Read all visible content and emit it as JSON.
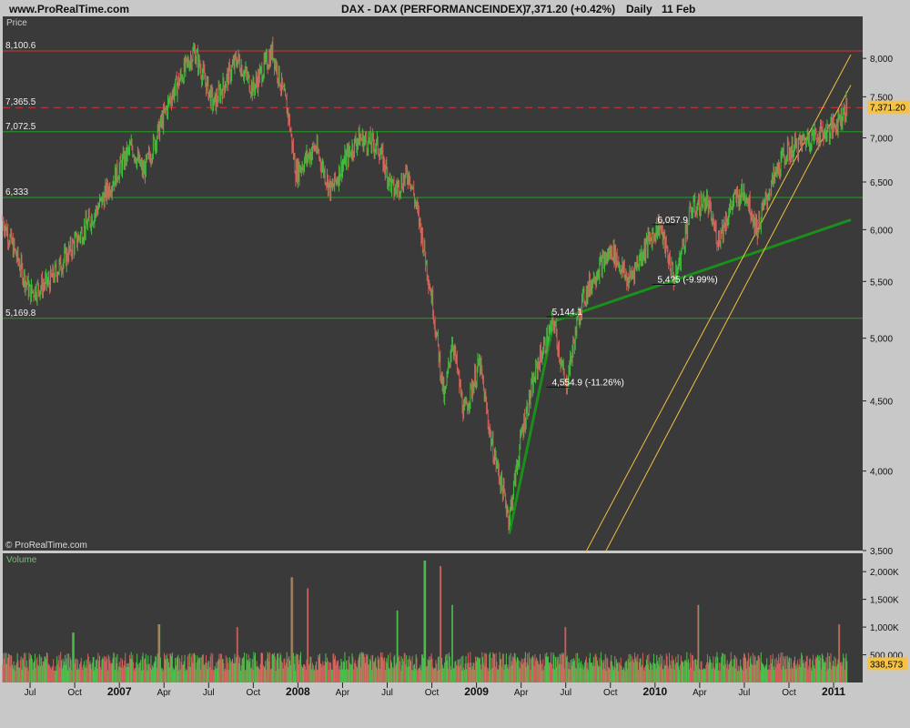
{
  "header": {
    "site": "www.ProRealTime.com",
    "instrument": "DAX - DAX (PERFORMANCEINDEX)",
    "quote": "7,371.20 (+0.42%)",
    "period": "Daily",
    "date": "11 Feb"
  },
  "chart_data": [
    {
      "type": "line",
      "panel_label": "Price",
      "watermark": "© ProRealTime.com",
      "x_labels": [
        "Jul",
        "Oct",
        "2007",
        "Apr",
        "Jul",
        "Oct",
        "2008",
        "Apr",
        "Jul",
        "Oct",
        "2009",
        "Apr",
        "Jul",
        "Oct",
        "2010",
        "Apr",
        "Jul",
        "Oct",
        "2011"
      ],
      "yaxis_ticks": [
        "8,000",
        "7,500",
        "7,000",
        "6,500",
        "6,000",
        "5,500",
        "5,000",
        "4,500",
        "4,000",
        "3,500"
      ],
      "ylim": [
        3500,
        8200
      ],
      "y_scale": "log",
      "last_price_label": "7,371.20",
      "anchors": [
        {
          "t": 0,
          "v": 6100
        },
        {
          "t": 0.035,
          "v": 5400
        },
        {
          "t": 0.06,
          "v": 5500
        },
        {
          "t": 0.12,
          "v": 6200
        },
        {
          "t": 0.165,
          "v": 6900
        },
        {
          "t": 0.18,
          "v": 6600
        },
        {
          "t": 0.215,
          "v": 7500
        },
        {
          "t": 0.245,
          "v": 8100
        },
        {
          "t": 0.27,
          "v": 7400
        },
        {
          "t": 0.3,
          "v": 8000
        },
        {
          "t": 0.32,
          "v": 7600
        },
        {
          "t": 0.345,
          "v": 8100
        },
        {
          "t": 0.365,
          "v": 7300
        },
        {
          "t": 0.375,
          "v": 6600
        },
        {
          "t": 0.4,
          "v": 6900
        },
        {
          "t": 0.42,
          "v": 6400
        },
        {
          "t": 0.435,
          "v": 6700
        },
        {
          "t": 0.455,
          "v": 7000
        },
        {
          "t": 0.48,
          "v": 6900
        },
        {
          "t": 0.5,
          "v": 6400
        },
        {
          "t": 0.52,
          "v": 6600
        },
        {
          "t": 0.535,
          "v": 6000
        },
        {
          "t": 0.55,
          "v": 5300
        },
        {
          "t": 0.565,
          "v": 4500
        },
        {
          "t": 0.575,
          "v": 5000
        },
        {
          "t": 0.59,
          "v": 4400
        },
        {
          "t": 0.61,
          "v": 4800
        },
        {
          "t": 0.625,
          "v": 4200
        },
        {
          "t": 0.648,
          "v": 3700
        },
        {
          "t": 0.665,
          "v": 4300
        },
        {
          "t": 0.685,
          "v": 4800
        },
        {
          "t": 0.705,
          "v": 5144
        },
        {
          "t": 0.72,
          "v": 4600
        },
        {
          "t": 0.74,
          "v": 5300
        },
        {
          "t": 0.76,
          "v": 5600
        },
        {
          "t": 0.78,
          "v": 5800
        },
        {
          "t": 0.8,
          "v": 5500
        },
        {
          "t": 0.82,
          "v": 5800
        },
        {
          "t": 0.84,
          "v": 6058
        },
        {
          "t": 0.86,
          "v": 5500
        },
        {
          "t": 0.88,
          "v": 6200
        },
        {
          "t": 0.9,
          "v": 6300
        },
        {
          "t": 0.915,
          "v": 5900
        },
        {
          "t": 0.935,
          "v": 6300
        },
        {
          "t": 0.95,
          "v": 6400
        },
        {
          "t": 0.965,
          "v": 6000
        },
        {
          "t": 0.98,
          "v": 6400
        },
        {
          "t": 0.99,
          "v": 6600
        },
        {
          "t": 1.0,
          "v": 6800
        },
        {
          "t": 1.03,
          "v": 7000
        },
        {
          "t": 1.06,
          "v": 7100
        },
        {
          "t": 1.08,
          "v": 7371
        }
      ],
      "horizontal_levels": [
        {
          "label": "8,100.6",
          "value": 8100.6,
          "style": "solid",
          "color": "#e03030"
        },
        {
          "label": "7,365.5",
          "value": 7365.5,
          "style": "dashed",
          "color": "#e03030"
        },
        {
          "label": "7,072.5",
          "value": 7072.5,
          "style": "solid",
          "color": "#20a020"
        },
        {
          "label": "6,333",
          "value": 6333,
          "style": "solid",
          "color": "#20a020"
        },
        {
          "label": "5,169.8",
          "value": 5169.8,
          "style": "solid",
          "color": "#20a020"
        }
      ],
      "annotations": [
        {
          "text": "6,057.9",
          "t": 0.84,
          "v": 6070
        },
        {
          "text": "5,144.1",
          "t": 0.705,
          "v": 5200
        },
        {
          "text": "4,554.9 (-11.26%)",
          "t": 0.705,
          "v": 4620
        },
        {
          "text": "5,4?5 (-9.99%)",
          "t": 0.84,
          "v": 5490
        }
      ]
    },
    {
      "type": "bar",
      "panel_label": "Volume",
      "yaxis_ticks": [
        "2,000K",
        "1,500K",
        "1,000K",
        "500,000"
      ],
      "ylim": [
        0,
        2200000
      ],
      "last_volume_label": "338,573",
      "volume_mean": 380000,
      "volume_spikes": [
        {
          "t": 0.09,
          "v": 900000
        },
        {
          "t": 0.2,
          "v": 1050000
        },
        {
          "t": 0.3,
          "v": 1000000
        },
        {
          "t": 0.37,
          "v": 1900000
        },
        {
          "t": 0.39,
          "v": 1700000
        },
        {
          "t": 0.505,
          "v": 1300000
        },
        {
          "t": 0.54,
          "v": 2200000
        },
        {
          "t": 0.56,
          "v": 2100000
        },
        {
          "t": 0.575,
          "v": 1400000
        },
        {
          "t": 0.72,
          "v": 1000000
        },
        {
          "t": 0.89,
          "v": 1400000
        },
        {
          "t": 1.07,
          "v": 1050000
        }
      ]
    }
  ]
}
